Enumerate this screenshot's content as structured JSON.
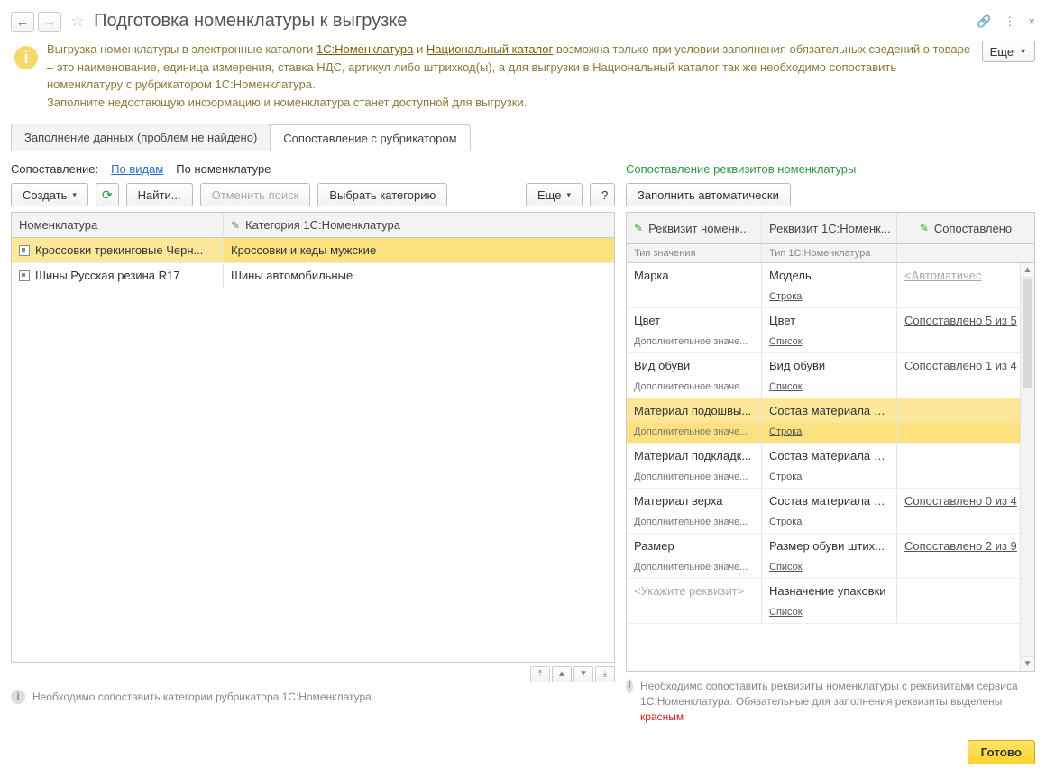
{
  "title": "Подготовка номенклатуры к выгрузке",
  "nav": {
    "back": "←",
    "fwd": "→"
  },
  "titlebar_icons": {
    "link": "🔗",
    "menu": "⋮",
    "close": "×"
  },
  "more_label": "Еще",
  "info": {
    "t1": "Выгрузка номенклатуры в электронные каталоги ",
    "link1": "1С:Номенклатура",
    "t2": " и ",
    "link2": "Национальный каталог",
    "t3": " возможна только при условии заполнения обязательных сведений о товаре – это наименование, единица измерения, ставка НДС, артикул либо штрихкод(ы), а для выгрузки в Национальный каталог так же необходимо сопоставить номенклатуру с рубрикатором 1С:Номенклатура.",
    "t4": "Заполните недостающую информацию и номенклатура станет доступной для выгрузки."
  },
  "tabs": [
    "Заполнение данных (проблем не найдено)",
    "Сопоставление с рубрикатором"
  ],
  "filter": {
    "label": "Сопоставление:",
    "opt1": "По видам",
    "opt2": "По номенклатуре"
  },
  "left_toolbar": {
    "create": "Создать",
    "find": "Найти...",
    "cancel": "Отменить поиск",
    "choose": "Выбрать категорию",
    "more": "Еще",
    "q": "?"
  },
  "left_headers": {
    "c1": "Номенклатура",
    "c2": "Категория 1С:Номенклатура"
  },
  "left_rows": [
    {
      "name": "Кроссовки трекинговые Черн...",
      "cat": "Кроссовки и кеды мужские",
      "sel": true
    },
    {
      "name": "Шины Русская резина R17",
      "cat": "Шины автомобильные",
      "sel": false
    }
  ],
  "left_footer": "Необходимо сопоставить категории рубрикатора 1С:Номенклатура.",
  "right_title": "Сопоставление реквизитов номенклатуры",
  "right_toolbar": {
    "auto": "Заполнить автоматически"
  },
  "right_headers": {
    "c1": "Реквизит номенк...",
    "c2": "Реквизит 1С:Номенк...",
    "c3": "Сопоставлено"
  },
  "right_subheaders": {
    "c1": "Тип значения",
    "c2": "Тип 1С:Номенклатура"
  },
  "right_rows": [
    {
      "a": "Марка",
      "b": "Модель",
      "m": "<Автоматичес",
      "msub": "",
      "sub1": "",
      "sub2": "Строка",
      "auto": true
    },
    {
      "a": "Цвет",
      "b": "Цвет",
      "m": "Сопоставлено 5 из 5",
      "sub1": "Дополнительное значе...",
      "sub2": "Список"
    },
    {
      "a": "Вид обуви",
      "b": "Вид обуви",
      "m": "Сопоставлено 1 из 4",
      "sub1": "Дополнительное значе...",
      "sub2": "Список"
    },
    {
      "a": "Материал подошвы...",
      "b": "Состав материала п...",
      "m": "",
      "sub1": "Дополнительное значе...",
      "sub2": "Строка",
      "sel": true
    },
    {
      "a": "Материал подкладк...",
      "b": "Состав материала п...",
      "m": "",
      "sub1": "Дополнительное значе...",
      "sub2": "Строка"
    },
    {
      "a": "Материал верха",
      "b": "Состав материала в...",
      "m": "Сопоставлено 0 из 4",
      "sub1": "Дополнительное значе...",
      "sub2": "Строка"
    },
    {
      "a": "Размер",
      "b": "Размер обуви штих...",
      "m": "Сопоставлено 2 из 9",
      "sub1": "Дополнительное значе...",
      "sub2": "Список"
    },
    {
      "a": "<Укажите реквизит>",
      "b": "Назначение упаковки",
      "m": "",
      "sub1": "",
      "sub2": "Список",
      "placeholder": true
    }
  ],
  "right_footer": {
    "t1": "Необходимо сопоставить реквизиты номенклатуры с реквизитами сервиса 1С:Номенклатура. Обязательные для заполнения реквизиты выделены ",
    "t2": "красным"
  },
  "done": "Готово"
}
